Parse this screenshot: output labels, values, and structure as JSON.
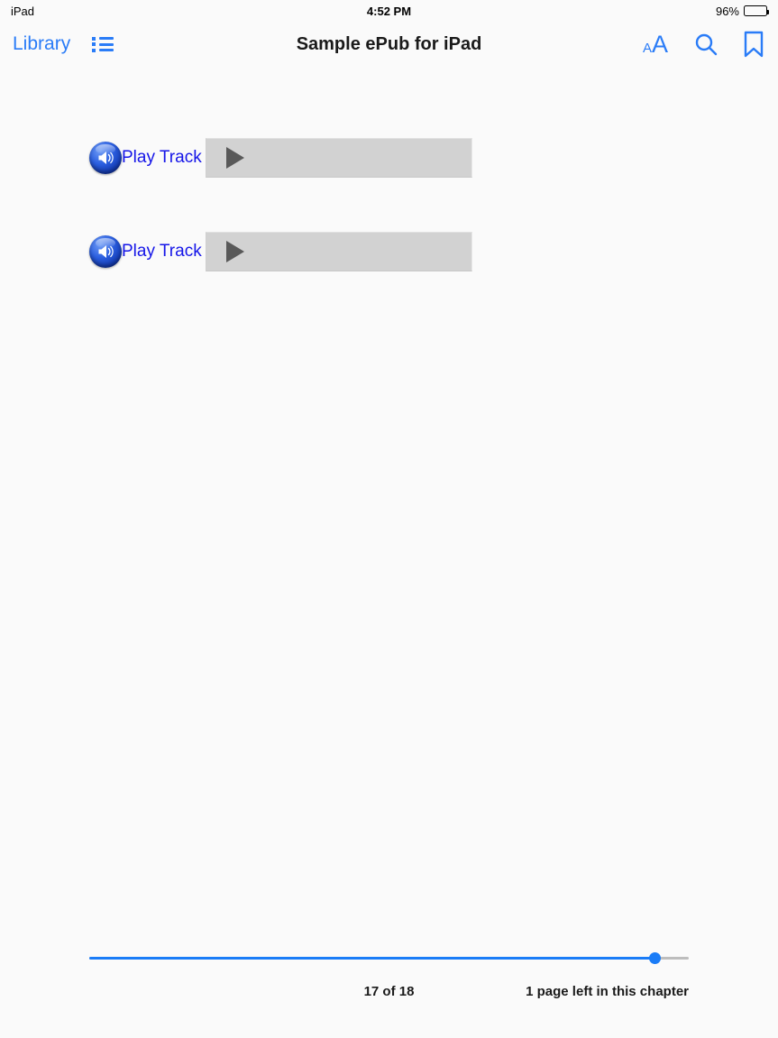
{
  "status_bar": {
    "device": "iPad",
    "time": "4:52 PM",
    "battery_percent": "96%",
    "battery_icon": "battery-full-icon"
  },
  "nav_bar": {
    "library_label": "Library",
    "toc_icon": "table-of-contents-icon",
    "title": "Sample ePub for iPad",
    "font_size_icon": "font-size-aa-icon",
    "font_size_small_label": "A",
    "font_size_large_label": "A",
    "search_icon": "search-icon",
    "bookmark_icon": "bookmark-icon"
  },
  "content": {
    "audio_blocks": [
      {
        "speaker_icon": "speaker-icon",
        "link_label": "Play Track",
        "player_icon": "play-triangle-icon"
      },
      {
        "speaker_icon": "speaker-icon",
        "link_label": "Play Track",
        "player_icon": "play-triangle-icon"
      }
    ]
  },
  "bottom_bar": {
    "page_indicator": "17 of 18",
    "chapter_remaining": "1 page left in this chapter",
    "progress_percent": 94
  },
  "colors": {
    "accent_blue": "#2a7cf7",
    "link_blue": "#1515e8",
    "page_background": "#fafafa",
    "player_gray": "#d2d2d2",
    "play_triangle_gray": "#595959"
  }
}
